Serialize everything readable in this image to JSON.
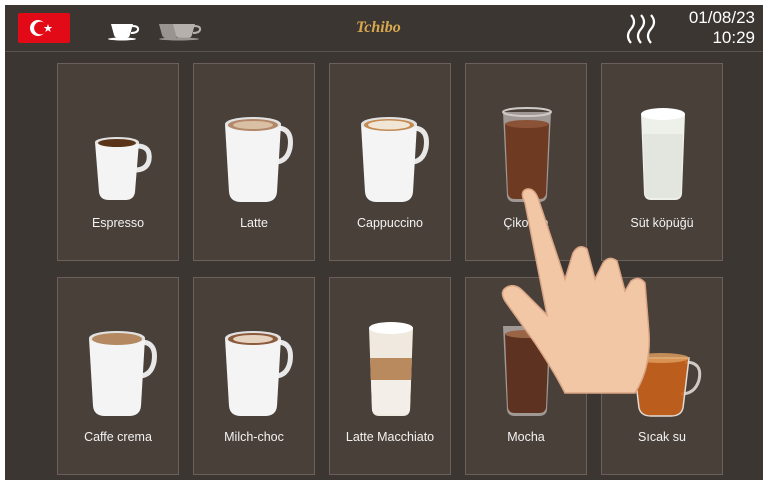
{
  "header": {
    "language_flag": "turkey-flag",
    "brand": "Tchibo",
    "date": "01/08/23",
    "time": "10:29"
  },
  "drinks": [
    {
      "label": "Espresso",
      "type": "espresso-cup"
    },
    {
      "label": "Latte",
      "type": "latte-cup"
    },
    {
      "label": "Cappuccino",
      "type": "cappuccino-cup"
    },
    {
      "label": "Çikolata",
      "type": "chocolate-glass"
    },
    {
      "label": "Süt köpüğü",
      "type": "milk-foam-glass"
    },
    {
      "label": "Caffe crema",
      "type": "crema-cup"
    },
    {
      "label": "Milch-choc",
      "type": "milch-choc-cup"
    },
    {
      "label": "Latte Macchiato",
      "type": "latte-macchiato-glass"
    },
    {
      "label": "Mocha",
      "type": "mocha-glass"
    },
    {
      "label": "Sıcak su",
      "type": "hot-water-cup"
    }
  ],
  "colors": {
    "background": "#3c3632",
    "tile": "#4a403a",
    "brand": "#d8a84e",
    "flag": "#e30a17"
  }
}
